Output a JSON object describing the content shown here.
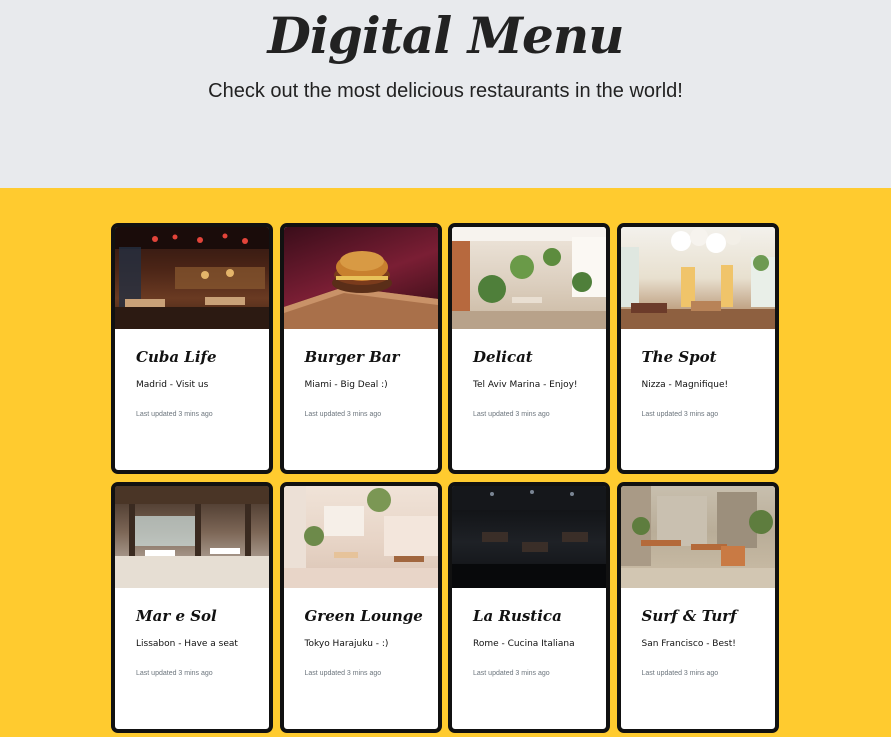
{
  "header": {
    "title": "Digital Menu",
    "subtitle": "Check out the most delicious restaurants in the world!"
  },
  "cards": [
    {
      "name": "Cuba Life",
      "desc": "Madrid - Visit us",
      "updated": "Last updated 3 mins ago",
      "photo": "dim-bar-interior-image"
    },
    {
      "name": "Burger Bar",
      "desc": "Miami - Big Deal :)",
      "updated": "Last updated 3 mins ago",
      "photo": "burger-on-board-image"
    },
    {
      "name": "Delicat",
      "desc": "Tel Aviv Marina - Enjoy!",
      "updated": "Last updated 3 mins ago",
      "photo": "bright-plant-cafe-image"
    },
    {
      "name": "The Spot",
      "desc": "Nizza - Magnifique!",
      "updated": "Last updated 3 mins ago",
      "photo": "white-dining-room-image"
    },
    {
      "name": "Mar e Sol",
      "desc": "Lissabon - Have a seat",
      "updated": "Last updated 3 mins ago",
      "photo": "beach-terrace-image"
    },
    {
      "name": "Green Lounge",
      "desc": "Tokyo Harajuku - :)",
      "updated": "Last updated 3 mins ago",
      "photo": "pink-cafe-image"
    },
    {
      "name": "La Rustica",
      "desc": "Rome - Cucina Italiana",
      "updated": "Last updated 3 mins ago",
      "photo": "dark-dining-hall-image"
    },
    {
      "name": "Surf & Turf",
      "desc": "San Francisco - Best!",
      "updated": "Last updated 3 mins ago",
      "photo": "outdoor-patio-image"
    }
  ],
  "colors": {
    "page_background": "#ffcb2f",
    "hero_background": "#e8eaed",
    "card_border": "#111111",
    "muted_text": "#6c757d"
  }
}
